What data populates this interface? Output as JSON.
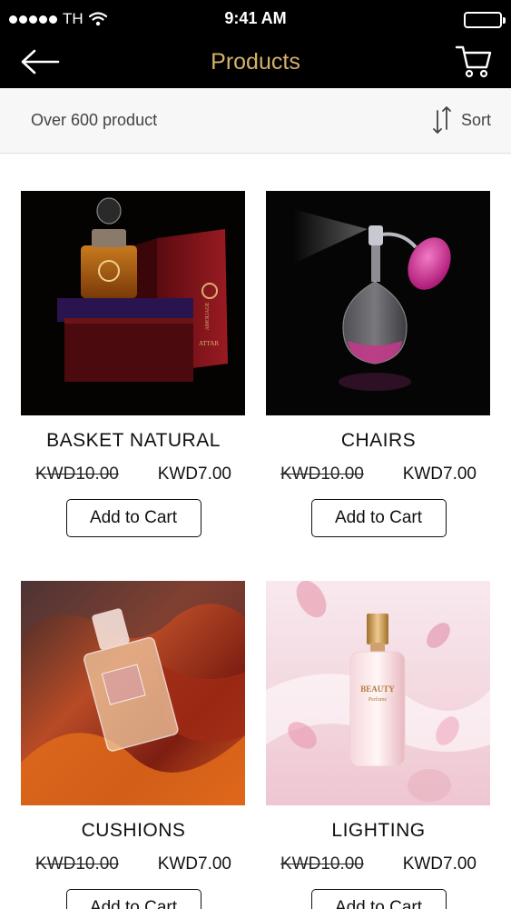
{
  "status": {
    "carrier": "TH",
    "time": "9:41 AM"
  },
  "nav": {
    "title": "Products",
    "title_color": "#d4b06a",
    "back_icon": "arrow-left-icon",
    "cart_icon": "cart-icon"
  },
  "toolbar": {
    "count_text": "Over 600 product",
    "sort_label": "Sort",
    "sort_icon": "sort-arrows-icon"
  },
  "products": [
    {
      "name": "BASKET NATURAL",
      "old_price": "KWD10.00",
      "price": "KWD7.00",
      "button": "Add to Cart"
    },
    {
      "name": "CHAIRS",
      "old_price": "KWD10.00",
      "price": "KWD7.00",
      "button": "Add to Cart"
    },
    {
      "name": "CUSHIONS",
      "old_price": "KWD10.00",
      "price": "KWD7.00",
      "button": "Add to Cart"
    },
    {
      "name": "LIGHTING",
      "old_price": "KWD10.00",
      "price": "KWD7.00",
      "button": "Add to Cart"
    }
  ],
  "image_labels": {
    "box_brand": "AMOUAGE",
    "box_sub": "ATTAR",
    "bottle_brand": "BEAUTY",
    "bottle_sub": "Perfume"
  }
}
